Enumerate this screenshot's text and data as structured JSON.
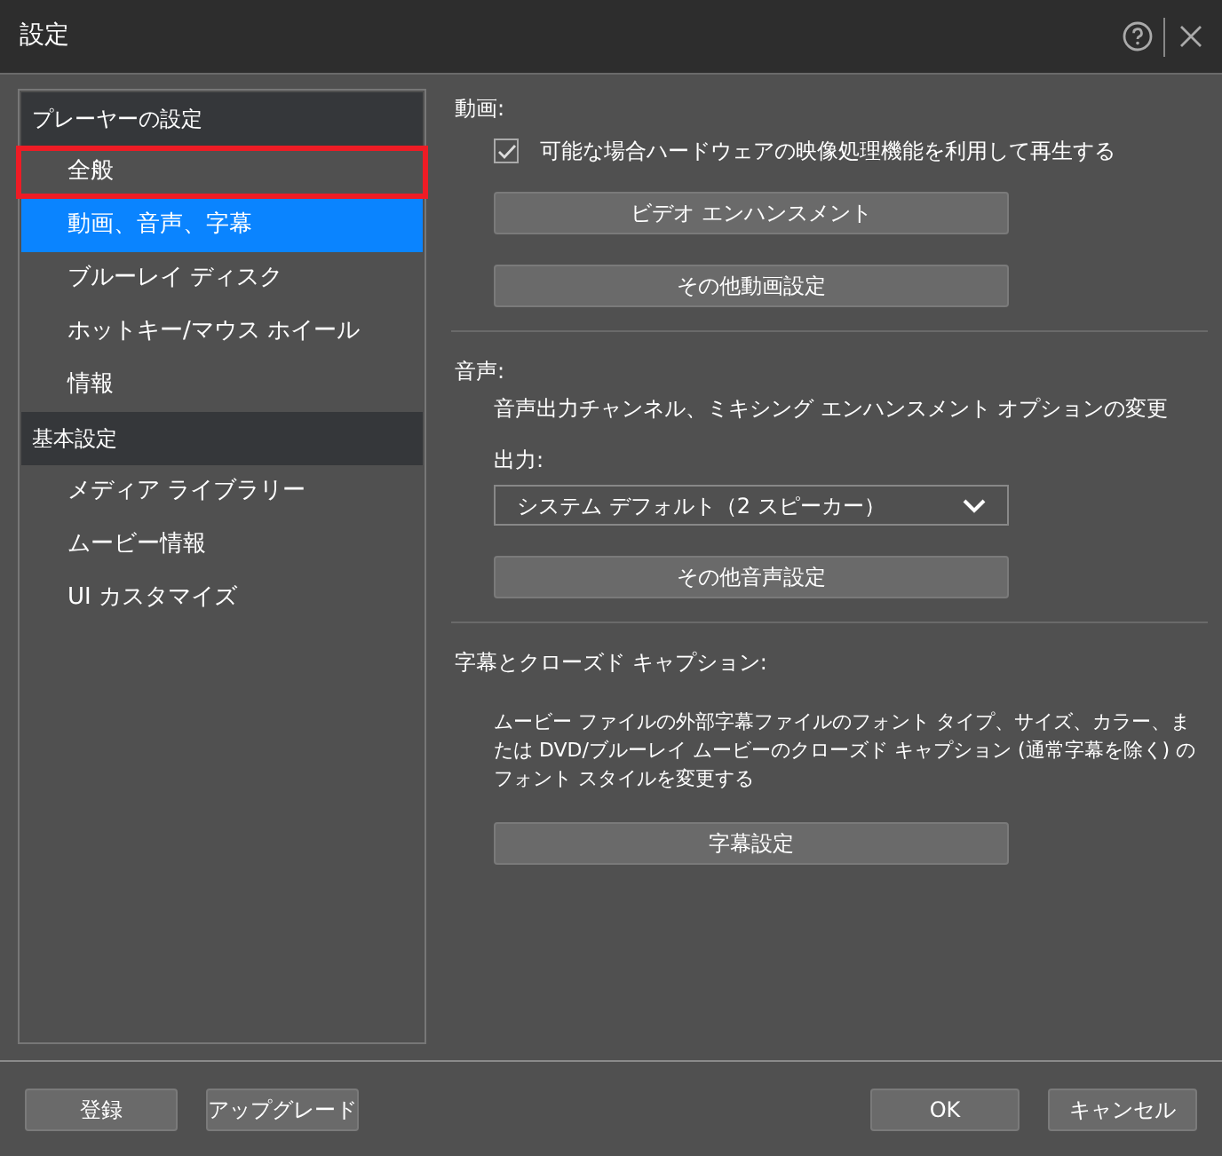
{
  "window": {
    "title": "設定"
  },
  "sidebar": {
    "groups": [
      {
        "title": "プレーヤーの設定",
        "items": [
          {
            "label": "全般",
            "selected": false,
            "annotated": true
          },
          {
            "label": "動画、音声、字幕",
            "selected": true,
            "annotated": false
          },
          {
            "label": "ブルーレイ ディスク",
            "selected": false,
            "annotated": false
          },
          {
            "label": "ホットキー/マウス ホイール",
            "selected": false,
            "annotated": false
          },
          {
            "label": "情報",
            "selected": false,
            "annotated": false
          }
        ]
      },
      {
        "title": "基本設定",
        "items": [
          {
            "label": "メディア ライブラリー",
            "selected": false,
            "annotated": false
          },
          {
            "label": "ムービー情報",
            "selected": false,
            "annotated": false
          },
          {
            "label": "UI カスタマイズ",
            "selected": false,
            "annotated": false
          }
        ]
      }
    ]
  },
  "video": {
    "heading": "動画:",
    "hardware_checkbox": {
      "label": "可能な場合ハードウェアの映像処理機能を利用して再生する",
      "checked": true
    },
    "buttons": [
      "ビデオ エンハンスメント",
      "その他動画設定"
    ]
  },
  "audio": {
    "heading": "音声:",
    "description": "音声出力チャンネル、ミキシング エンハンスメント オプションの変更",
    "output_label": "出力:",
    "output_value": "システム デフォルト（2 スピーカー）",
    "button": "その他音声設定"
  },
  "subtitles": {
    "heading": "字幕とクローズド キャプション:",
    "description": "ムービー ファイルの外部字幕ファイルのフォント タイプ、サイズ、カラー、または DVD/ブルーレイ ムービーのクローズド キャプション (通常字幕を除く) のフォント スタイルを変更する",
    "button": "字幕設定"
  },
  "footer": {
    "left_buttons": [
      "登録",
      "アップグレード"
    ],
    "right_buttons": [
      "OK",
      "キャンセル"
    ]
  }
}
